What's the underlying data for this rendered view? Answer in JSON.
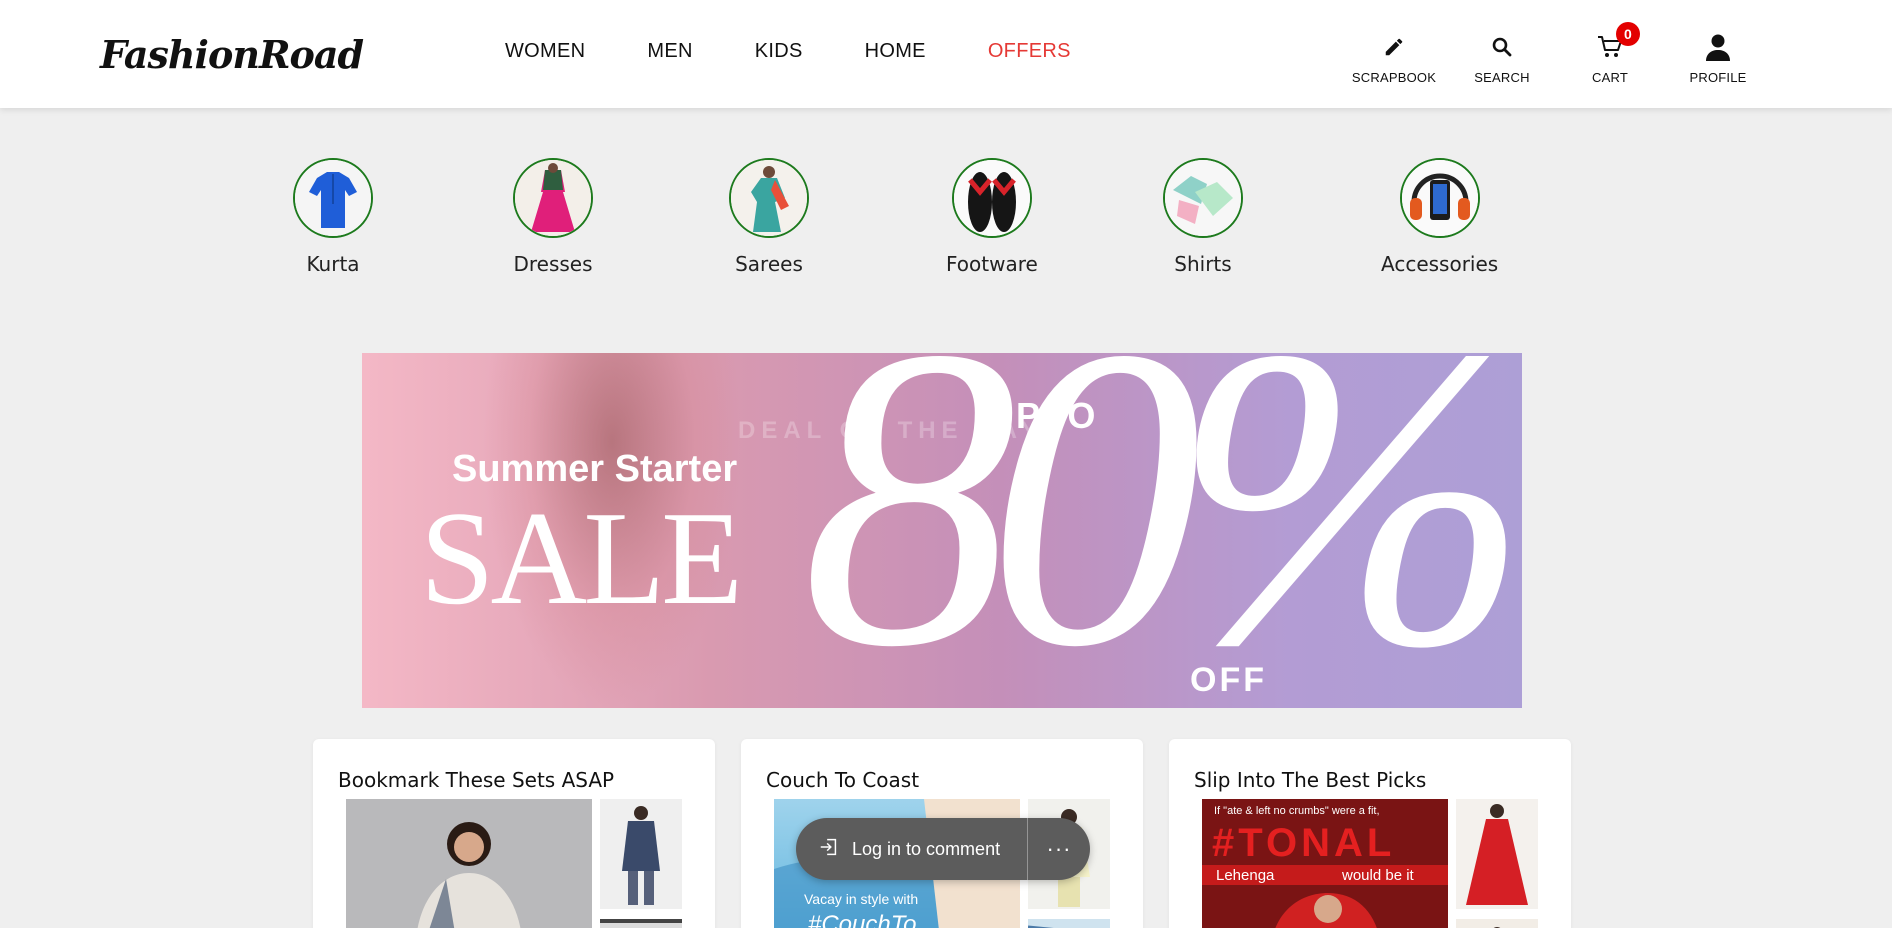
{
  "brand": {
    "logo": "FashionRoad"
  },
  "nav": {
    "items": [
      {
        "label": "WOMEN"
      },
      {
        "label": "MEN"
      },
      {
        "label": "KIDS"
      },
      {
        "label": "HOME"
      },
      {
        "label": "OFFERS",
        "highlight_color": "#e53935"
      }
    ]
  },
  "actions": {
    "scrapbook": {
      "label": "SCRAPBOOK",
      "icon": "pencil-icon"
    },
    "search": {
      "label": "SEARCH",
      "icon": "search-icon"
    },
    "cart": {
      "label": "CART",
      "icon": "cart-icon",
      "count": "0"
    },
    "profile": {
      "label": "PROFILE",
      "icon": "person-icon"
    }
  },
  "categories": [
    {
      "label": "Kurta"
    },
    {
      "label": "Dresses"
    },
    {
      "label": "Sarees"
    },
    {
      "label": "Footware"
    },
    {
      "label": "Shirts"
    },
    {
      "label": "Accessories"
    }
  ],
  "banner": {
    "headline": "Summer Starter",
    "sale": "SALE",
    "upto": "UPTO",
    "faded": "DEAL OF THE DAY",
    "percent": "80%",
    "off": "OFF"
  },
  "cards": [
    {
      "title": "Bookmark These Sets ASAP"
    },
    {
      "title": "Couch To Coast",
      "caption": "Vacay in style with",
      "tag": "#CouchTo"
    },
    {
      "title": "Slip Into The Best Picks",
      "quote": "If \"ate & left no crumbs\" were a fit,",
      "tonal": "#TONAL",
      "lehenga": "Lehenga",
      "would": "would be it"
    }
  ],
  "toast": {
    "login": "Log in to comment",
    "more": "···"
  },
  "colors": {
    "accent": "#e53935",
    "circle_border": "#1d7a1d",
    "badge": "#e30000"
  }
}
